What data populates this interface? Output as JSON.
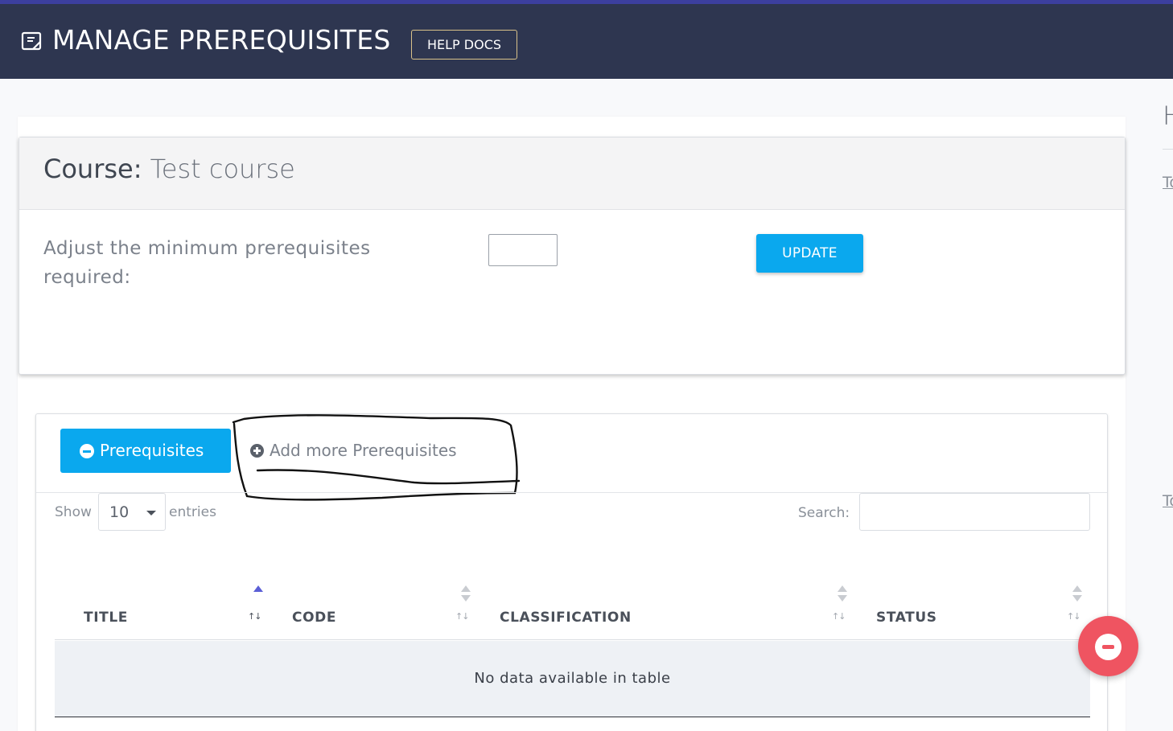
{
  "header": {
    "title": "MANAGE PREREQUISITES",
    "help_label": "HELP DOCS"
  },
  "course": {
    "label": "Course:",
    "name": "Test course",
    "adjust_label": "Adjust the minimum prerequisites required:",
    "min_value": "",
    "update_label": "UPDATE"
  },
  "tabs": {
    "active_label": "Prerequisites",
    "add_label": "Add more Prerequisites"
  },
  "table": {
    "show_label": "Show",
    "page_length": "10",
    "entries_label": "entries",
    "search_label": "Search:",
    "search_value": "",
    "columns": [
      "TITLE",
      "CODE",
      "CLASSIFICATION",
      "STATUS"
    ],
    "sorted_column": "TITLE",
    "sort_direction": "ascending",
    "empty_message": "No data available in table"
  },
  "sidebar": {
    "heading": "H",
    "link1": "To",
    "link2": "To"
  },
  "colors": {
    "header_bg": "#2e3650",
    "accent": "#0aa8ee",
    "fab": "#ef5461"
  },
  "icons": {
    "header": "document-icon",
    "active_tab": "minus-circle-icon",
    "add_tab": "plus-circle-icon",
    "fab": "minus-circle-icon"
  }
}
